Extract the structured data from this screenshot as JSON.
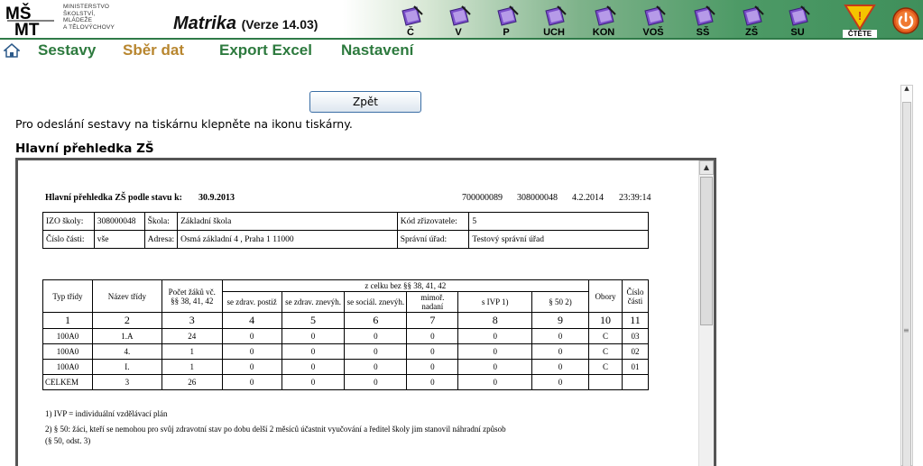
{
  "header": {
    "ministry_lines": [
      "MINISTERSTVO",
      "ŠKOLSTVÍ,",
      "MLÁDEŽE",
      "A TĚLOVÝCHOVY"
    ],
    "title": "Matrika",
    "version": "(Verze 14.03)",
    "toolbar": [
      {
        "label": "Č",
        "color": "#7a4fc9"
      },
      {
        "label": "V",
        "color": "#7a4fc9"
      },
      {
        "label": "P",
        "color": "#7a4fc9"
      },
      {
        "label": "UCH",
        "color": "#7a4fc9"
      },
      {
        "label": "KON",
        "color": "#7a4fc9"
      },
      {
        "label": "VOŠ",
        "color": "#7a4fc9"
      },
      {
        "label": "SŠ",
        "color": "#7a4fc9"
      },
      {
        "label": "ZŠ",
        "color": "#7a4fc9"
      },
      {
        "label": "SU",
        "color": "#7a4fc9"
      }
    ],
    "warning_label": "ČTĚTE"
  },
  "menu": {
    "items": [
      {
        "label": "Sestavy",
        "active": false
      },
      {
        "label": "Sběr dat",
        "active": true
      },
      {
        "label": "Export Excel",
        "active": false
      },
      {
        "label": "Nastavení",
        "active": false
      }
    ]
  },
  "content": {
    "back_label": "Zpět",
    "instruction": "Pro odeslání sestavy na tiskárnu klepněte na ikonu tiskárny.",
    "section_title": "Hlavní přehledka ZŠ"
  },
  "report": {
    "heading": "Hlavní přehledka ZŠ podle stavu k:",
    "state_date": "30.9.2013",
    "code1": "700000089",
    "code2": "308000048",
    "print_date": "4.2.2014",
    "print_time": "23:39:14",
    "info": {
      "izo_label": "IZO školy:",
      "izo": "308000048",
      "school_label": "Škola:",
      "school": "Základní škola",
      "founder_label": "Kód zřizovatele:",
      "founder": "5",
      "part_label": "Číslo části:",
      "part": "vše",
      "address_label": "Adresa:",
      "address": "Osmá základní 4 , Praha 1 11000",
      "office_label": "Správní úřad:",
      "office": "Testový správní úřad"
    },
    "headers": {
      "typ": "Typ třídy",
      "nazev": "Název třídy",
      "pocet": "Počet žáků vč. §§ 38, 41, 42",
      "zcelku": "z celku bez §§ 38, 41, 42",
      "postiz": "se zdrav. postiž",
      "znevyh": "se zdrav. znevýh.",
      "social": "se sociál. znevýh.",
      "nadani": "mimoř. nadaní",
      "ivp": "s IVP 1)",
      "p50": "§ 50 2)",
      "obory": "Obory",
      "cislo": "Číslo části"
    },
    "col_numbers": [
      "1",
      "2",
      "3",
      "4",
      "5",
      "6",
      "7",
      "8",
      "9",
      "10",
      "11"
    ],
    "rows": [
      [
        "100A0",
        "1.A",
        "24",
        "0",
        "0",
        "0",
        "0",
        "0",
        "0",
        "C",
        "03"
      ],
      [
        "100A0",
        "4.",
        "1",
        "0",
        "0",
        "0",
        "0",
        "0",
        "0",
        "C",
        "02"
      ],
      [
        "100A0",
        "I.",
        "1",
        "0",
        "0",
        "0",
        "0",
        "0",
        "0",
        "C",
        "01"
      ],
      [
        "CELKEM",
        "3",
        "26",
        "0",
        "0",
        "0",
        "0",
        "0",
        "0",
        "",
        ""
      ]
    ],
    "notes": [
      "1) IVP = individuální vzdělávací plán",
      "2) § 50: žáci, kteří se nemohou pro svůj zdravotní stav po dobu delší 2 měsíců účastnit vyučování a ředitel školy jim stanovil náhradní způsob",
      "(§ 50, odst. 3)"
    ]
  }
}
